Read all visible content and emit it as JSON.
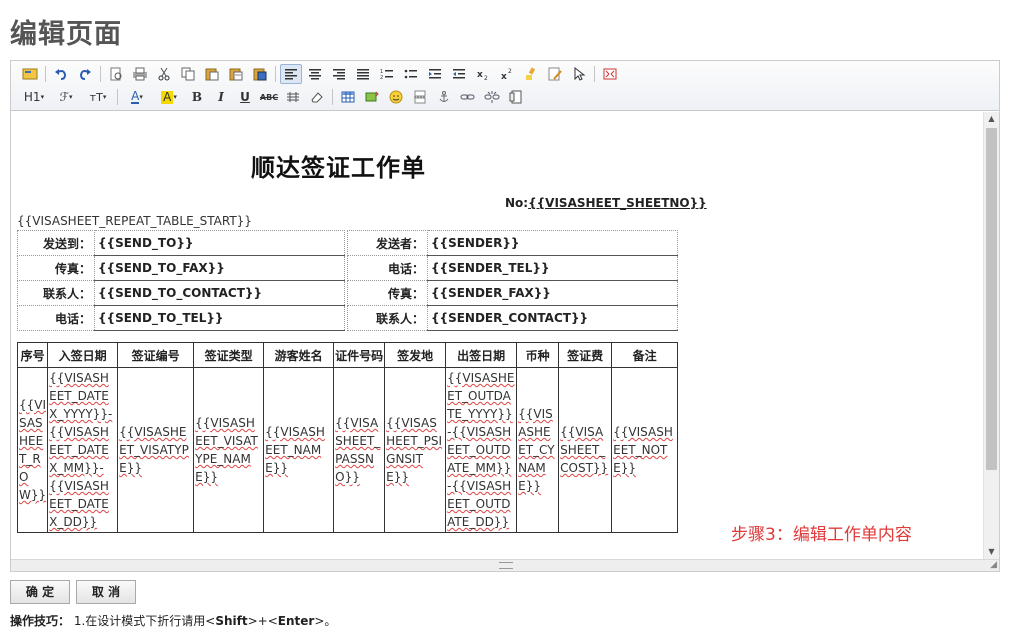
{
  "page": {
    "title": "编辑页面"
  },
  "toolbar": {
    "heading": "H1",
    "font_family": "ℱ",
    "font_size": "тT",
    "font_color": "A",
    "highlight": "A",
    "bold": "B",
    "italic": "I",
    "underline": "U",
    "strikethrough": "ABC"
  },
  "document": {
    "title": "顺达签证工作单",
    "no_prefix": "No:",
    "no_value": "{{VISASHEET_SHEETNO}}",
    "repeat_start": "{{VISASHEET_REPEAT_TABLE_START}}",
    "info_left": [
      {
        "label": "发送到：",
        "value": "{{SEND_TO}}"
      },
      {
        "label": "传真：",
        "value": "{{SEND_TO_FAX}}"
      },
      {
        "label": "联系人：",
        "value": "{{SEND_TO_CONTACT}}"
      },
      {
        "label": "电话：",
        "value": "{{SEND_TO_TEL}}"
      }
    ],
    "info_right": [
      {
        "label": "发送者：",
        "value": "{{SENDER}}"
      },
      {
        "label": "电话：",
        "value": "{{SENDER_TEL}}"
      },
      {
        "label": "传真：",
        "value": "{{SENDER_FAX}}"
      },
      {
        "label": "联系人：",
        "value": "{{SENDER_CONTACT}}"
      }
    ],
    "table_headers": [
      "序号",
      "入签日期",
      "签证编号",
      "签证类型",
      "游客姓名",
      "证件号码",
      "签发地",
      "出签日期",
      "币种",
      "签证费",
      "备注"
    ],
    "table_row": [
      "{{VISASHEET_ROW}}",
      "{{VISASHEET_DATEX_YYYY}}-{{VISASHEET_DATEX_MM}}-{{VISASHEET_DATEX_DD}}",
      "{{VISASHEET_VISATYPE}}",
      "{{VISASHEET_VISATYPE_NAME}}",
      "{{VISASHEET_NAME}}",
      "{{VISASHEET_PASSNO}}",
      "{{VISASHEET_PSIGNSITE}}",
      "{{VISASHEET_OUTDATE_YYYY}}-{{VISASHEET_OUTDATE_MM}}-{{VISASHEET_OUTDATE_DD}}",
      "{{VISASHEET_CYNAME}}",
      "{{VISASHEET_COST}}",
      "{{VISASHEET_NOTE}}"
    ]
  },
  "annotation": {
    "step": "步骤3：编辑工作单内容"
  },
  "buttons": {
    "ok": "确 定",
    "cancel": "取 消"
  },
  "tip": {
    "label": "操作技巧：",
    "text_before": "1.在设计模式下折行请用<",
    "key1": "Shift",
    "middle": ">+<",
    "key2": "Enter",
    "text_after": ">。"
  },
  "colors": {
    "annotation": "#e03a3a",
    "title": "#555555"
  }
}
